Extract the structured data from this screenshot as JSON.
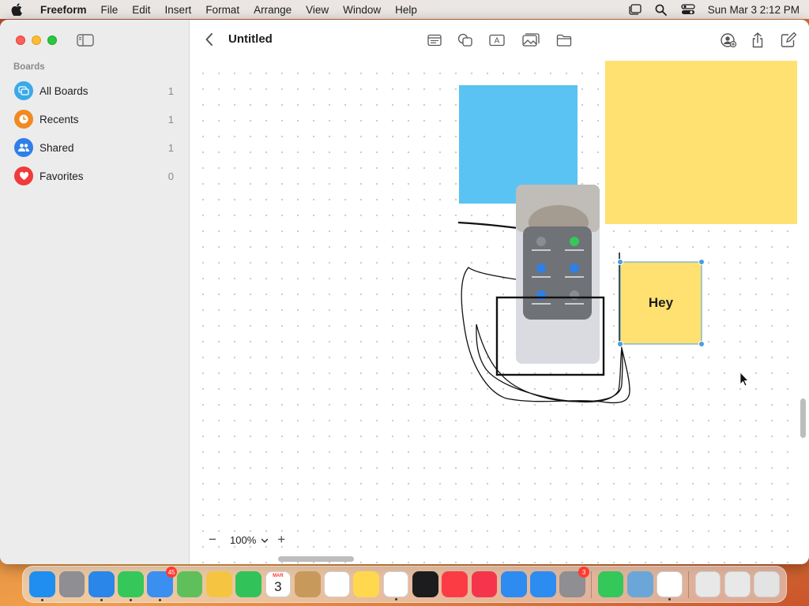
{
  "menubar": {
    "app_name": "Freeform",
    "items": [
      "File",
      "Edit",
      "Insert",
      "Format",
      "Arrange",
      "View",
      "Window",
      "Help"
    ],
    "clock": "Sun Mar 3  2:12 PM"
  },
  "sidebar": {
    "section_title": "Boards",
    "items": [
      {
        "label": "All Boards",
        "count": "1",
        "icon": "boards-icon",
        "color": "#3aa9e8"
      },
      {
        "label": "Recents",
        "count": "1",
        "icon": "clock-icon",
        "color": "#f08a24"
      },
      {
        "label": "Shared",
        "count": "1",
        "icon": "people-icon",
        "color": "#2f7fe8"
      },
      {
        "label": "Favorites",
        "count": "0",
        "icon": "heart-icon",
        "color": "#ef3b3b"
      }
    ]
  },
  "toolbar": {
    "title": "Untitled",
    "tools": [
      "sticky-note-icon",
      "shapes-icon",
      "text-box-icon",
      "media-icon",
      "folder-icon"
    ],
    "actions": [
      "collaborate-icon",
      "share-icon",
      "new-board-icon"
    ]
  },
  "canvas": {
    "sticky_note_text": "Hey",
    "colors": {
      "blue_square": "#5ac3f3",
      "yellow_note": "#fee170",
      "selection": "#4a9de0"
    }
  },
  "zoom": {
    "value": "100%",
    "minus": "−",
    "plus": "+"
  },
  "dock": {
    "apps": [
      {
        "name": "Finder",
        "color": "#1f8ef0",
        "running": true
      },
      {
        "name": "Launchpad",
        "color": "#8e8e93",
        "running": false
      },
      {
        "name": "Safari",
        "color": "#2a86e8",
        "running": true
      },
      {
        "name": "Messages",
        "color": "#35c759",
        "running": true
      },
      {
        "name": "Mail",
        "color": "#3b8ff0",
        "running": true,
        "badge": "45"
      },
      {
        "name": "Maps",
        "color": "#5fbf5a",
        "running": false
      },
      {
        "name": "Photos",
        "color": "#f5c542",
        "running": false
      },
      {
        "name": "FaceTime",
        "color": "#32c25a",
        "running": false
      },
      {
        "name": "Calendar",
        "color": "#ffffff",
        "running": false,
        "calendar_month": "MAR",
        "calendar_day": "3"
      },
      {
        "name": "Contacts",
        "color": "#c79a5c",
        "running": false
      },
      {
        "name": "Reminders",
        "color": "#ffffff",
        "running": false
      },
      {
        "name": "Notes",
        "color": "#ffd84d",
        "running": false
      },
      {
        "name": "Freeform",
        "color": "#ffffff",
        "running": true
      },
      {
        "name": "TV",
        "color": "#1c1c1e",
        "running": false
      },
      {
        "name": "Music",
        "color": "#fc3c44",
        "running": false
      },
      {
        "name": "News",
        "color": "#f5354b",
        "running": false
      },
      {
        "name": "Keynote",
        "color": "#2e8cf0",
        "running": false
      },
      {
        "name": "App Store",
        "color": "#2d8cf0",
        "running": false
      },
      {
        "name": "System Settings",
        "color": "#8e8e93",
        "running": false,
        "badge": "3"
      },
      {
        "name": "Find My",
        "color": "#34c759",
        "running": false
      },
      {
        "name": "Preview",
        "color": "#6aa7d8",
        "running": false
      },
      {
        "name": "Chrome",
        "color": "#ffffff",
        "running": true
      },
      {
        "name": "Downloads",
        "color": "#e8e8e8",
        "running": false
      },
      {
        "name": "Screenshots",
        "color": "#e8e8e8",
        "running": false
      },
      {
        "name": "Trash",
        "color": "#e3e3e3",
        "running": false
      }
    ]
  }
}
